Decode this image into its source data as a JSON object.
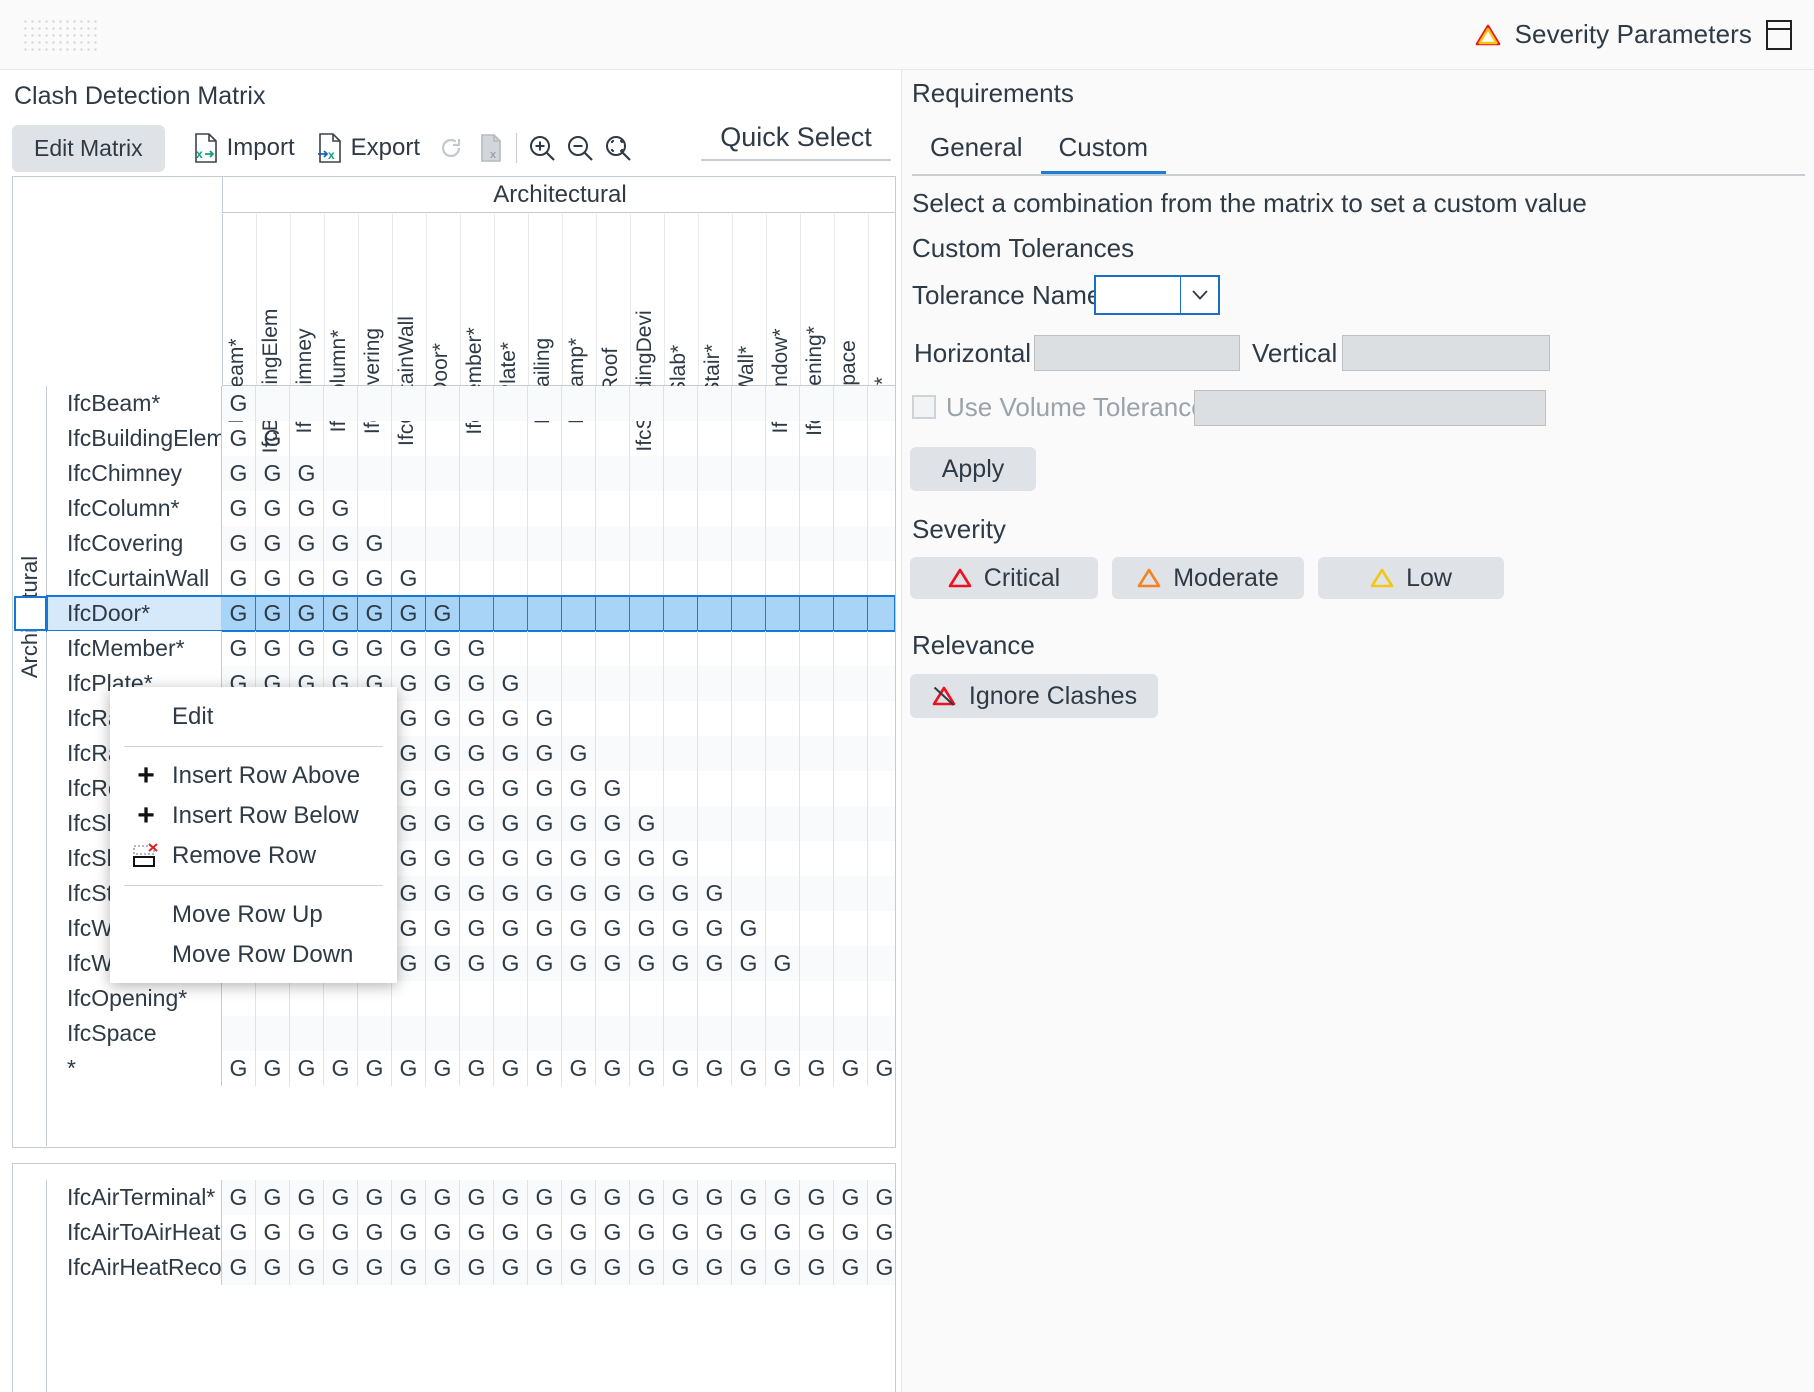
{
  "titlebar": {
    "grip_icon": "drag-grip-icon",
    "severity_parameters_label": "Severity Parameters",
    "warning_icon": "warning-triangle-icon",
    "window_icon": "window-panel-icon"
  },
  "left_panel": {
    "title": "Clash Detection Matrix",
    "toolbar": {
      "edit_matrix_label": "Edit Matrix",
      "import_label": "Import",
      "export_label": "Export",
      "refresh_icon": "refresh-icon",
      "copy_icon": "copy-sheet-icon",
      "zoom_in_icon": "zoom-in-icon",
      "zoom_out_icon": "zoom-out-icon",
      "zoom_fit_icon": "zoom-fit-icon",
      "quick_select_label": "Quick Select"
    },
    "matrix": {
      "group_header": "Architectural",
      "side_group_label": "Architectural",
      "cell_token": "G",
      "columns": [
        "IfcBeam*",
        "IfcBuildingElem",
        "IfcChimney",
        "IfcColumn*",
        "IfcCovering",
        "IfcCurtainWall",
        "IfcDoor*",
        "IfcMember*",
        "IfcPlate*",
        "IfcRailing",
        "IfcRamp*",
        "IfcRoof",
        "IfcShadingDevi",
        "IfcSlab*",
        "IfcStair*",
        "IfcWall*",
        "IfcWindow*",
        "IfcOpening*",
        "IfcSpace",
        "*"
      ],
      "rows": [
        {
          "label": "IfcBeam*",
          "filled": 1,
          "selected": false
        },
        {
          "label": "IfcBuildingElem",
          "filled": 2,
          "selected": false
        },
        {
          "label": "IfcChimney",
          "filled": 3,
          "selected": false
        },
        {
          "label": "IfcColumn*",
          "filled": 4,
          "selected": false
        },
        {
          "label": "IfcCovering",
          "filled": 5,
          "selected": false
        },
        {
          "label": "IfcCurtainWall",
          "filled": 6,
          "selected": false
        },
        {
          "label": "IfcDoor*",
          "filled": 7,
          "selected": true
        },
        {
          "label": "IfcMember*",
          "filled": 8,
          "selected": false
        },
        {
          "label": "IfcPlate*",
          "filled": 9,
          "selected": false
        },
        {
          "label": "IfcRailing",
          "filled": 10,
          "selected": false
        },
        {
          "label": "IfcRamp*",
          "filled": 11,
          "selected": false
        },
        {
          "label": "IfcRoof",
          "filled": 12,
          "selected": false
        },
        {
          "label": "IfcShadingDevi",
          "filled": 13,
          "selected": false
        },
        {
          "label": "IfcSlab*",
          "filled": 14,
          "selected": false
        },
        {
          "label": "IfcStair*",
          "filled": 15,
          "selected": false
        },
        {
          "label": "IfcWall*",
          "filled": 16,
          "selected": false
        },
        {
          "label": "IfcWindow*",
          "filled": 17,
          "selected": false
        },
        {
          "label": "IfcOpening*",
          "filled": 0,
          "selected": false
        },
        {
          "label": "IfcSpace",
          "filled": 0,
          "selected": false
        },
        {
          "label": "*",
          "filled": 20,
          "selected": false
        }
      ],
      "rows_bottom": [
        {
          "label": "IfcAirTerminal*",
          "filled": 20
        },
        {
          "label": "IfcAirToAirHeat",
          "filled": 20
        },
        {
          "label": "IfcAirHeatRecov",
          "filled": 20
        }
      ]
    },
    "context_menu": {
      "items": [
        {
          "label": "Edit",
          "icon": "none"
        },
        {
          "label": "Insert Row Above",
          "icon": "plus-icon"
        },
        {
          "label": "Insert Row Below",
          "icon": "plus-icon"
        },
        {
          "label": "Remove Row",
          "icon": "remove-row-icon"
        },
        {
          "label": "Move Row Up",
          "icon": "none"
        },
        {
          "label": "Move Row Down",
          "icon": "none"
        }
      ]
    }
  },
  "right_panel": {
    "requirements_title": "Requirements",
    "tabs": [
      {
        "label": "General",
        "active": false
      },
      {
        "label": "Custom",
        "active": true
      }
    ],
    "hint": "Select a combination from the matrix to set a custom value",
    "custom_tolerances": {
      "section_title": "Custom Tolerances",
      "tolerance_name_label": "Tolerance Name",
      "tolerance_name_value": "",
      "dropdown_icon": "chevron-down-icon",
      "horizontal_label": "Horizontal",
      "horizontal_value": "",
      "vertical_label": "Vertical",
      "vertical_value": "",
      "use_volume_tolerance_label": "Use Volume Tolerance",
      "use_volume_tolerance_checked": false,
      "volume_tolerance_value": "",
      "apply_label": "Apply"
    },
    "severity": {
      "section_title": "Severity",
      "buttons": [
        {
          "label": "Critical",
          "icon": "warning-triangle-icon",
          "color": "#f01020"
        },
        {
          "label": "Moderate",
          "icon": "warning-triangle-icon",
          "color": "#f58220"
        },
        {
          "label": "Low",
          "icon": "warning-triangle-icon",
          "color": "#f2c713"
        }
      ]
    },
    "relevance": {
      "section_title": "Relevance",
      "ignore_clashes_label": "Ignore Clashes",
      "ignore_icon": "warning-triangle-crossed-icon",
      "ignore_color": "#f01020"
    }
  },
  "theme": {
    "accent": "#1c7ed6",
    "selection_fill": "#a8d4f7",
    "selection_border": "#1479d6",
    "button_bg": "#dfe3e8"
  }
}
